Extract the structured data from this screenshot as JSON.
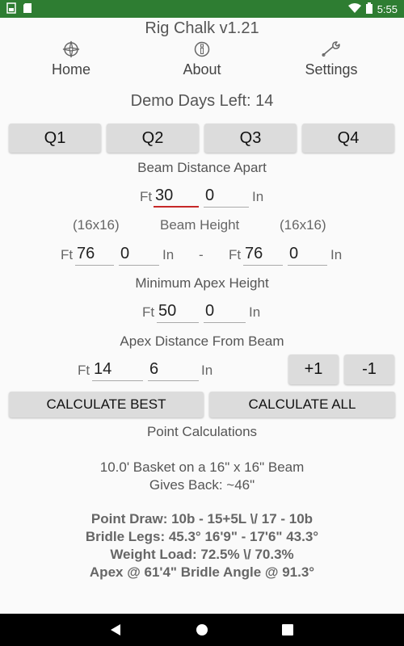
{
  "statusbar": {
    "time": "5:55"
  },
  "app": {
    "title": "Rig Chalk v1.21"
  },
  "nav": {
    "home": "Home",
    "about": "About",
    "settings": "Settings"
  },
  "demo_text": "Demo Days Left: 14",
  "quadrants": [
    "Q1",
    "Q2",
    "Q3",
    "Q4"
  ],
  "beam_distance": {
    "label": "Beam Distance Apart",
    "ft_unit": "Ft",
    "ft_value": "30",
    "in_value": "0",
    "in_unit": "In"
  },
  "beam_height": {
    "label": "Beam Height",
    "left_size": "(16x16)",
    "right_size": "(16x16)",
    "left_ft_unit": "Ft",
    "left_ft": "76",
    "left_in": "0",
    "left_in_unit": "In",
    "separator": "-",
    "right_ft_unit": "Ft",
    "right_ft": "76",
    "right_in": "0",
    "right_in_unit": "In"
  },
  "apex_height": {
    "label": "Minimum Apex Height",
    "ft_unit": "Ft",
    "ft_value": "50",
    "in_value": "0",
    "in_unit": "In"
  },
  "apex_distance": {
    "label": "Apex Distance From Beam",
    "ft_unit": "Ft",
    "ft_value": "14",
    "in_value": "6",
    "in_unit": "In",
    "plus": "+1",
    "minus": "-1"
  },
  "actions": {
    "calc_best": "CALCULATE BEST",
    "calc_all": "CALCULATE ALL"
  },
  "results": {
    "heading": "Point Calculations",
    "line1": "10.0' Basket on a 16\" x 16\" Beam",
    "line2": "Gives Back: ~46\"",
    "point_draw": "Point Draw: 10b - 15+5L  \\/  17 - 10b",
    "bridle_legs": "Bridle Legs: 45.3° 16'9\" - 17'6\" 43.3°",
    "weight_load": "Weight Load: 72.5% \\/ 70.3%",
    "apex": "Apex @ 61'4\"   Bridle Angle @ 91.3°"
  }
}
